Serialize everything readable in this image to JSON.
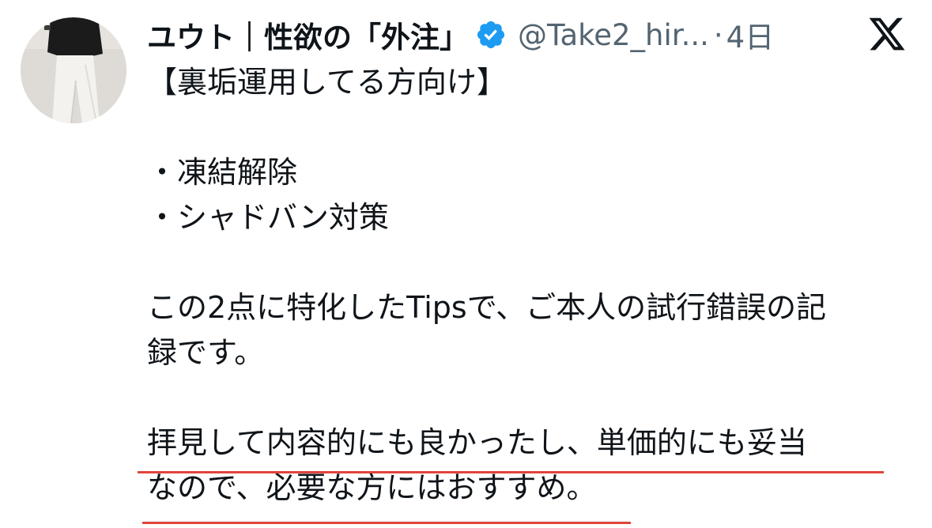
{
  "tweet": {
    "display_name": "ユウト｜性欲の「外注」",
    "handle": "@Take2_hir...",
    "separator": "·",
    "time": "4日",
    "lines": {
      "l1": "【裏垢運用してる方向け】",
      "l2": "・凍結解除",
      "l3": "・シャドバン対策",
      "l4": "この2点に特化したTipsで、ご本人の試行錯誤の記",
      "l5": "録です。",
      "l6": "拝見して内容的にも良かったし、単価的にも妥当",
      "l7": "なので、必要な方にはおすすめ。"
    }
  },
  "colors": {
    "verified_badge": "#1d9bf0",
    "secondary_text": "#536471",
    "annotation_underline": "#e0443b"
  },
  "icons": {
    "verified": "verified-badge-icon",
    "platform": "x-logo-icon"
  }
}
